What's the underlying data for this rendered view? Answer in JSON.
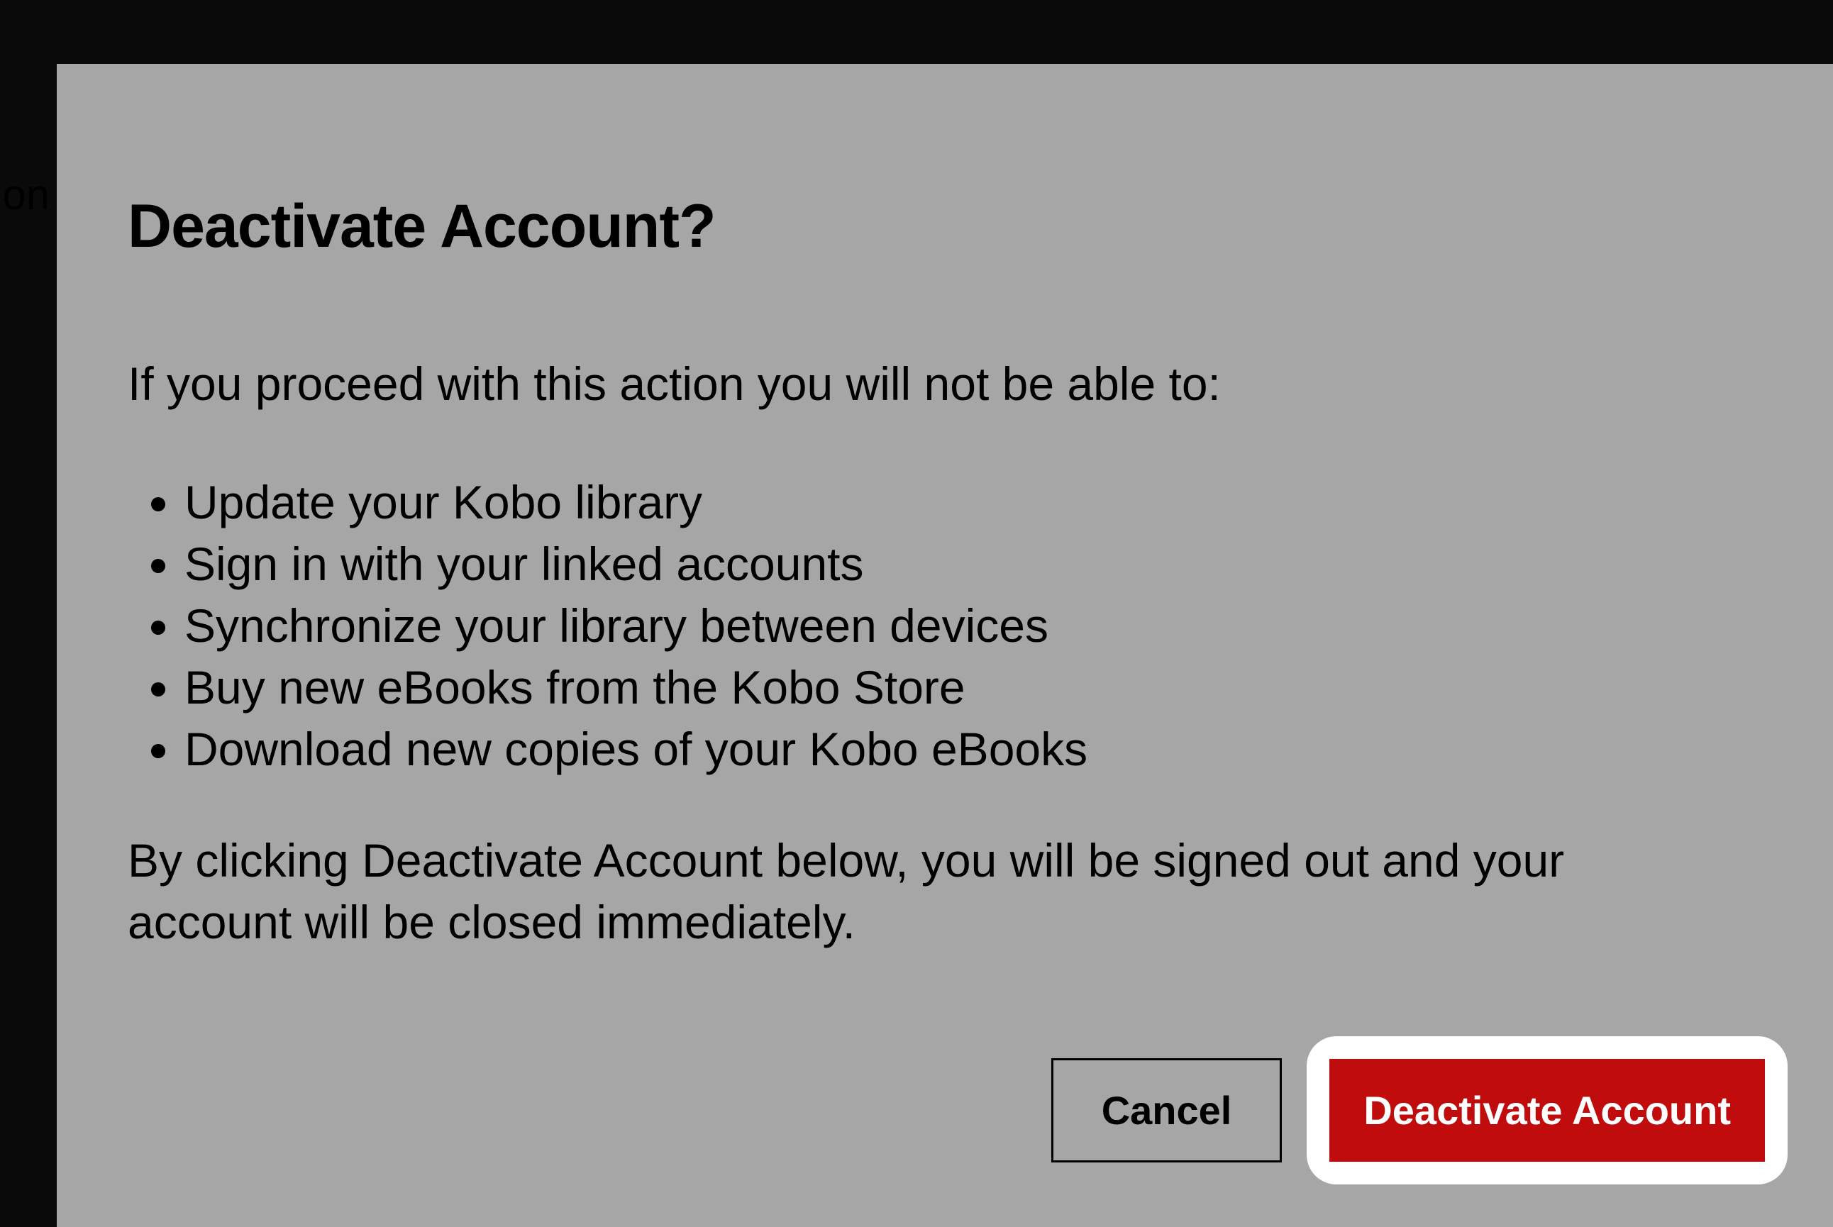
{
  "background": {
    "partial_text": "ion"
  },
  "modal": {
    "title": "Deactivate Account?",
    "intro": "If you proceed with this action you will not be able to:",
    "warnings": [
      "Update your Kobo library",
      "Sign in with your linked accounts",
      "Synchronize your library between devices",
      "Buy new eBooks from the Kobo Store",
      "Download new copies of your Kobo eBooks"
    ],
    "closing": "By clicking Deactivate Account below, you will be signed out and your account will be closed immediately.",
    "buttons": {
      "cancel": "Cancel",
      "confirm": "Deactivate Account"
    }
  }
}
